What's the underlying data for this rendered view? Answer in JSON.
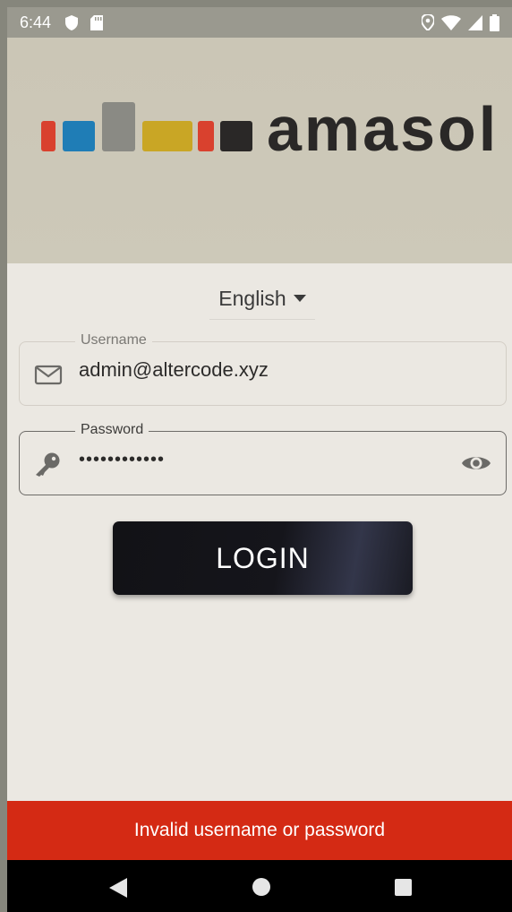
{
  "status_bar": {
    "time": "6:44",
    "icons": [
      "shield-icon",
      "sd-card-icon",
      "location-icon",
      "wifi-icon",
      "signal-icon",
      "battery-icon"
    ]
  },
  "header": {
    "logo_text": "amasol",
    "logo_block_colors": [
      "#d9412e",
      "#1f7db6",
      "#8a8a84",
      "#c9a625",
      "#d9412e",
      "#2a2827"
    ]
  },
  "language": {
    "selected": "English",
    "icon": "caret-down-icon"
  },
  "username": {
    "label": "Username",
    "value": "admin@altercode.xyz",
    "icon": "mail-icon"
  },
  "password": {
    "label": "Password",
    "value": "••••••••••••",
    "icon": "key-icon",
    "toggle_icon": "eye-icon"
  },
  "login_button": {
    "label": "LOGIN"
  },
  "error": {
    "message": "Invalid username or password",
    "color": "#d42a14"
  },
  "nav_bar": {
    "icons": [
      "back-icon",
      "home-icon",
      "recents-icon"
    ]
  }
}
